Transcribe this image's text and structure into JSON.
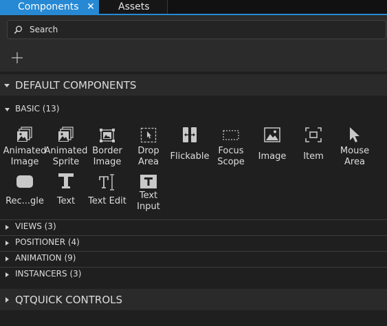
{
  "tabs": {
    "components": "Components",
    "close": "✕",
    "assets": "Assets"
  },
  "search": {
    "placeholder": "Search",
    "value": ""
  },
  "sections": {
    "default": "DEFAULT COMPONENTS",
    "qtquick": "QTQUICK CONTROLS"
  },
  "categories": {
    "basic": "BASIC (13)",
    "views": "VIEWS (3)",
    "positioner": "POSITIONER (4)",
    "animation": "ANIMATION (9)",
    "instancers": "INSTANCERS (3)"
  },
  "items": [
    {
      "label": "Animated\nImage",
      "icon": "animated-image-icon"
    },
    {
      "label": "Animated\nSprite",
      "icon": "animated-sprite-icon"
    },
    {
      "label": "Border\nImage",
      "icon": "border-image-icon"
    },
    {
      "label": "Drop\nArea",
      "icon": "drop-area-icon"
    },
    {
      "label": "Flickable",
      "icon": "flickable-icon"
    },
    {
      "label": "Focus\nScope",
      "icon": "focus-scope-icon"
    },
    {
      "label": "Image",
      "icon": "image-icon"
    },
    {
      "label": "Item",
      "icon": "item-icon"
    },
    {
      "label": "Mouse\nArea",
      "icon": "mouse-area-icon"
    },
    {
      "label": "Rec...gle",
      "icon": "rectangle-icon"
    },
    {
      "label": "Text",
      "icon": "text-icon"
    },
    {
      "label": "Text Edit",
      "icon": "text-edit-icon"
    },
    {
      "label": "Text\nInput",
      "icon": "text-input-icon"
    }
  ]
}
